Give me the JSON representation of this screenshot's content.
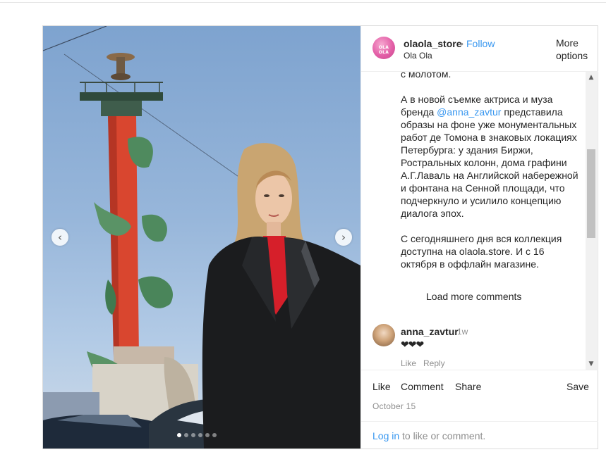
{
  "post": {
    "username": "olaola_store",
    "separator": "•",
    "follow_label": "Follow",
    "full_name": "Ola Ola",
    "avatar_text": "OLA OLA",
    "more_options_label": "More options",
    "caption": {
      "line0": "с молотом.",
      "paragraph1_before": "А в новой съемке актриса и муза бренда ",
      "mention": "@anna_zavtur",
      "paragraph1_after": " представила образы на фоне уже монументальных работ де Томона в знаковых локациях Петербурга: у здания Биржи, Ростральных колонн, дома графини А.Г.Лаваль на Английской набережной и фонтана на Сенной площади, что подчеркнуло и усилило концепцию диалога эпох.",
      "paragraph2": "С сегодняшнего дня вся коллекция доступна на olaola.store. И с 16 октября в оффлайн магазине."
    },
    "load_more_label": "Load more comments",
    "comment": {
      "username": "anna_zavtur",
      "time": "1w",
      "text": "❤❤❤",
      "like_label": "Like",
      "reply_label": "Reply"
    },
    "actions": {
      "like": "Like",
      "comment": "Comment",
      "share": "Share",
      "save": "Save"
    },
    "date": "October 15",
    "login_link": "Log in",
    "login_rest": "to like or comment.",
    "carousel": {
      "prev_icon": "chevron-left-icon",
      "next_icon": "chevron-right-icon",
      "slide_count": 6,
      "active_slide": 1
    },
    "scrollbar": {
      "up_icon": "scroll-up-arrow-icon",
      "down_icon": "scroll-down-arrow-icon"
    }
  }
}
